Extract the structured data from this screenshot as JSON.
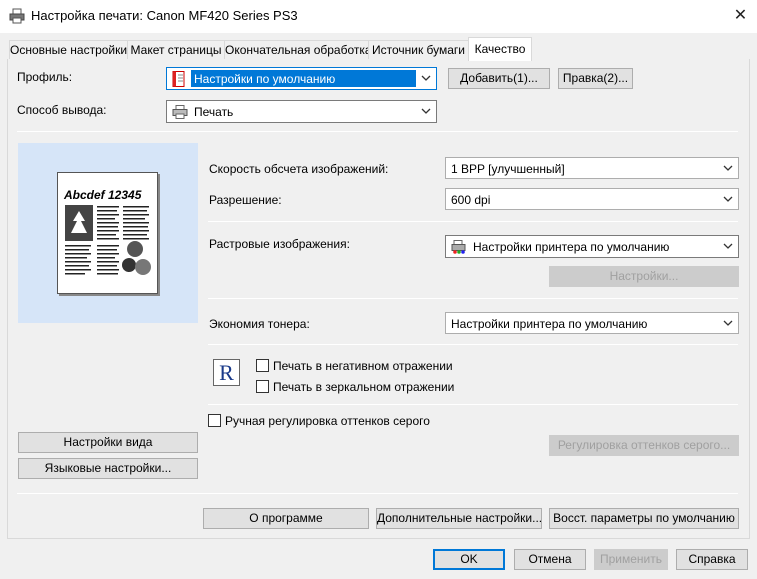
{
  "window": {
    "title": "Настройка печати: Canon MF420 Series PS3",
    "close": "✕"
  },
  "tabs": [
    {
      "label": "Основные настройки"
    },
    {
      "label": "Макет страницы"
    },
    {
      "label": "Окончательная обработка"
    },
    {
      "label": "Источник бумаги"
    },
    {
      "label": "Качество"
    }
  ],
  "profile": {
    "label": "Профиль:",
    "value": "Настройки по умолчанию",
    "add_button": "Добавить(1)...",
    "edit_button": "Правка(2)..."
  },
  "output": {
    "label": "Способ вывода:",
    "value": "Печать"
  },
  "preview": {
    "sample_text": "Abcdef 12345",
    "view_settings_button": "Настройки вида",
    "language_settings_button": "Языковые настройки..."
  },
  "quality": {
    "scan_speed_label": "Скорость обсчета изображений:",
    "scan_speed_value": "1 BPP [улучшенный]",
    "resolution_label": "Разрешение:",
    "resolution_value": "600 dpi",
    "raster_label": "Растровые изображения:",
    "raster_value": "Настройки принтера по умолчанию",
    "raster_settings_button": "Настройки...",
    "toner_label": "Экономия тонера:",
    "toner_value": "Настройки принтера по умолчанию",
    "r_symbol": "R",
    "negative_label": "Печать в негативном отражении",
    "mirror_label": "Печать в зеркальном отражении",
    "grayscale_label": "Ручная регулировка оттенков серого",
    "grayscale_button": "Регулировка оттенков серого..."
  },
  "page_buttons": {
    "about": "О программе",
    "advanced": "Дополнительные настройки...",
    "restore": "Восст. параметры по умолчанию"
  },
  "dialog_buttons": {
    "ok": "OK",
    "cancel": "Отмена",
    "apply": "Применить",
    "help": "Справка"
  },
  "colors": {
    "accent": "#0078d7",
    "preview_bg": "#d6e5f8"
  }
}
